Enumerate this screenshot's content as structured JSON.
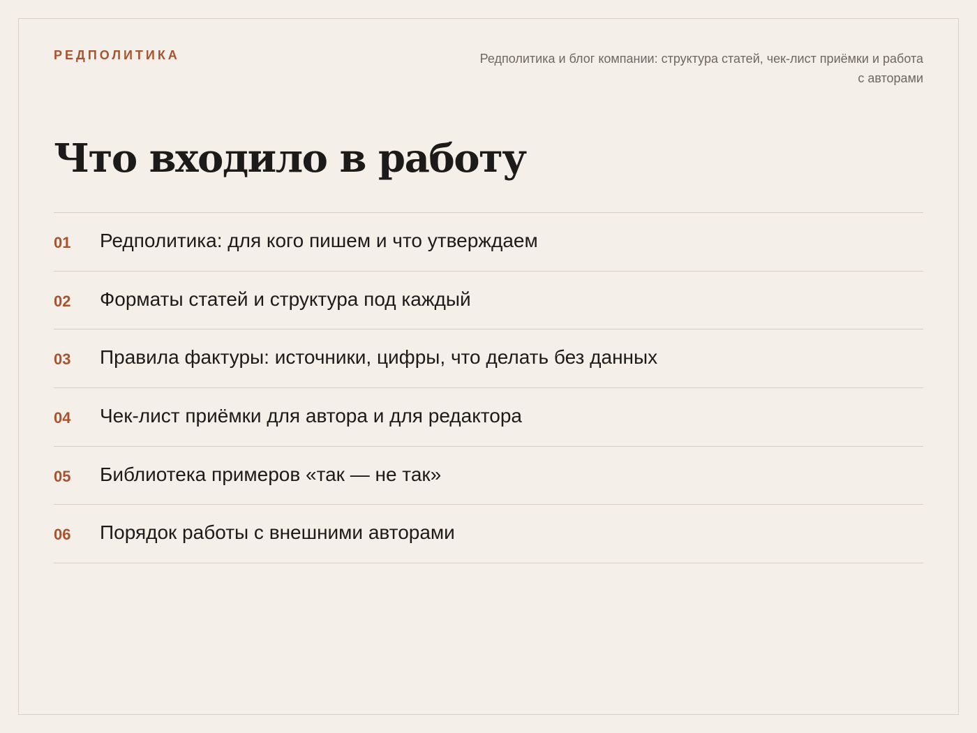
{
  "header": {
    "eyebrow": "РЕДПОЛИТИКА",
    "caption": "Редполитика и блог компании: структура статей, чек-лист приёмки и работа с авторами"
  },
  "title": "Что входило в работу",
  "items": [
    {
      "num": "01",
      "text": "Редполитика: для кого пишем и что утверждаем"
    },
    {
      "num": "02",
      "text": "Форматы статей и структура под каждый"
    },
    {
      "num": "03",
      "text": "Правила фактуры: источники, цифры, что делать без данных"
    },
    {
      "num": "04",
      "text": "Чек-лист приёмки для автора и для редактора"
    },
    {
      "num": "05",
      "text": "Библиотека примеров «так — не так»"
    },
    {
      "num": "06",
      "text": "Порядок работы с внешними авторами"
    }
  ],
  "colors": {
    "accent": "#a45430",
    "text": "#1d1b19",
    "muted": "#6e6862",
    "background": "#f4efe9",
    "rule": "#d6d0c9"
  }
}
